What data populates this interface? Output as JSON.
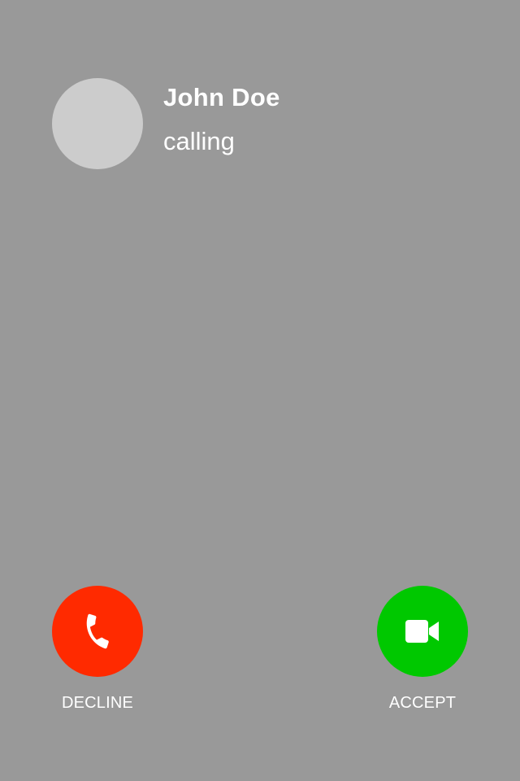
{
  "call": {
    "caller_name": "John Doe",
    "status": "calling"
  },
  "actions": {
    "decline": {
      "label": "DECLINE",
      "color": "#ff2a00",
      "icon": "phone-hangup-icon"
    },
    "accept": {
      "label": "ACCEPT",
      "color": "#00c800",
      "icon": "video-camera-icon"
    }
  },
  "theme": {
    "background": "#999999",
    "avatar_placeholder": "#cccccc",
    "text": "#ffffff"
  }
}
